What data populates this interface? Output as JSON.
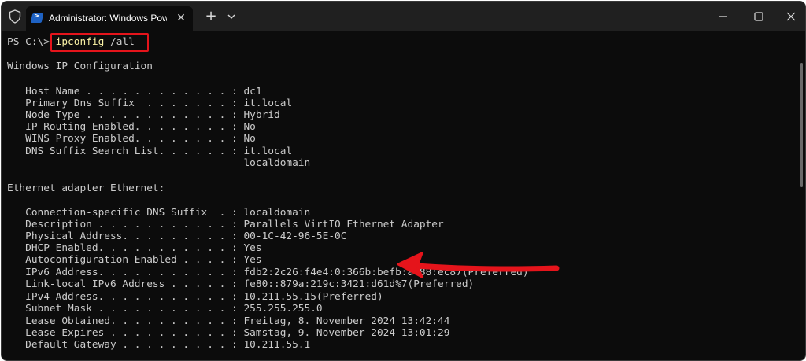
{
  "window": {
    "tab_title": "Administrator: Windows PowerShell",
    "tab_close_glyph": "✕",
    "new_tab_glyph": "+",
    "icons": {
      "shield": "shield-icon",
      "tab": "powershell-icon",
      "new_tab": "plus-icon",
      "dropdown": "chevron-down-icon",
      "minimize": "minimize-icon",
      "maximize": "maximize-icon",
      "close": "close-icon"
    },
    "colors": {
      "terminal_bg": "#0c0c0c",
      "titlebar_bg": "#202020",
      "text": "#cccccc",
      "command": "#f9f1a5",
      "highlight": "#e5141b"
    }
  },
  "terminal": {
    "prompt": "PS C:\\> ",
    "command": "ipconfig",
    "argument": " /all",
    "lines": [
      "Windows IP Configuration",
      "   Host Name . . . . . . . . . . . . : dc1",
      "   Primary Dns Suffix  . . . . . . . : it.local",
      "   Node Type . . . . . . . . . . . . : Hybrid",
      "   IP Routing Enabled. . . . . . . . : No",
      "   WINS Proxy Enabled. . . . . . . . : No",
      "   DNS Suffix Search List. . . . . . : it.local",
      "                                       localdomain",
      "Ethernet adapter Ethernet:",
      "   Connection-specific DNS Suffix  . : localdomain",
      "   Description . . . . . . . . . . . : Parallels VirtIO Ethernet Adapter",
      "   Physical Address. . . . . . . . . : 00-1C-42-96-5E-0C",
      "   DHCP Enabled. . . . . . . . . . . : Yes",
      "   Autoconfiguration Enabled . . . . : Yes",
      "   IPv6 Address. . . . . . . . . . . : fdb2:2c26:f4e4:0:366b:befb:ac88:ec87(Preferred)",
      "   Link-local IPv6 Address . . . . . : fe80::879a:219c:3421:d61d%7(Preferred)",
      "   IPv4 Address. . . . . . . . . . . : 10.211.55.15(Preferred)",
      "   Subnet Mask . . . . . . . . . . . : 255.255.255.0",
      "   Lease Obtained. . . . . . . . . . : Freitag, 8. November 2024 13:42:44",
      "   Lease Expires . . . . . . . . . . : Samstag, 9. November 2024 13:01:29",
      "   Default Gateway . . . . . . . . . : 10.211.55.1"
    ]
  }
}
